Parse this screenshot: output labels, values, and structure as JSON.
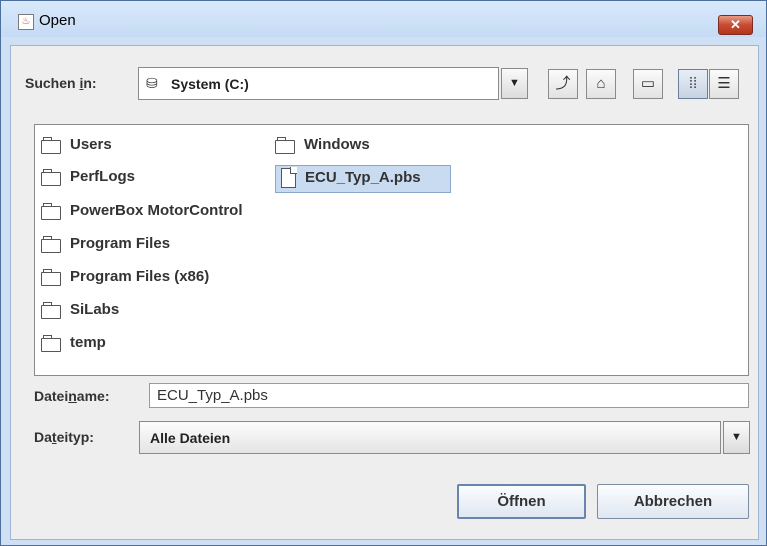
{
  "window": {
    "title": "Open",
    "close_glyph": "✕"
  },
  "toolbar": {
    "lookin_label_pre": "Suchen ",
    "lookin_label_u": "i",
    "lookin_label_post": "n:",
    "lookin_value": "System (C:)",
    "icons": [
      "up-one-level-icon",
      "home-icon",
      "new-folder-icon",
      "list-view-icon",
      "details-view-icon"
    ]
  },
  "files": [
    {
      "name": "Users",
      "type": "folder"
    },
    {
      "name": "PerfLogs",
      "type": "folder"
    },
    {
      "name": "PowerBox MotorControl",
      "type": "folder"
    },
    {
      "name": "Program Files",
      "type": "folder"
    },
    {
      "name": "Program Files (x86)",
      "type": "folder"
    },
    {
      "name": "SiLabs",
      "type": "folder"
    },
    {
      "name": "temp",
      "type": "folder"
    },
    {
      "name": "Windows",
      "type": "folder"
    },
    {
      "name": "ECU_Typ_A.pbs",
      "type": "file",
      "selected": true
    }
  ],
  "filename": {
    "label_pre": "Datei",
    "label_u": "n",
    "label_post": "ame:",
    "value": "ECU_Typ_A.pbs"
  },
  "filetype": {
    "label_pre": "Da",
    "label_u": "t",
    "label_post": "eityp:",
    "value": "Alle Dateien"
  },
  "buttons": {
    "open": "Öffnen",
    "cancel": "Abbrechen"
  }
}
